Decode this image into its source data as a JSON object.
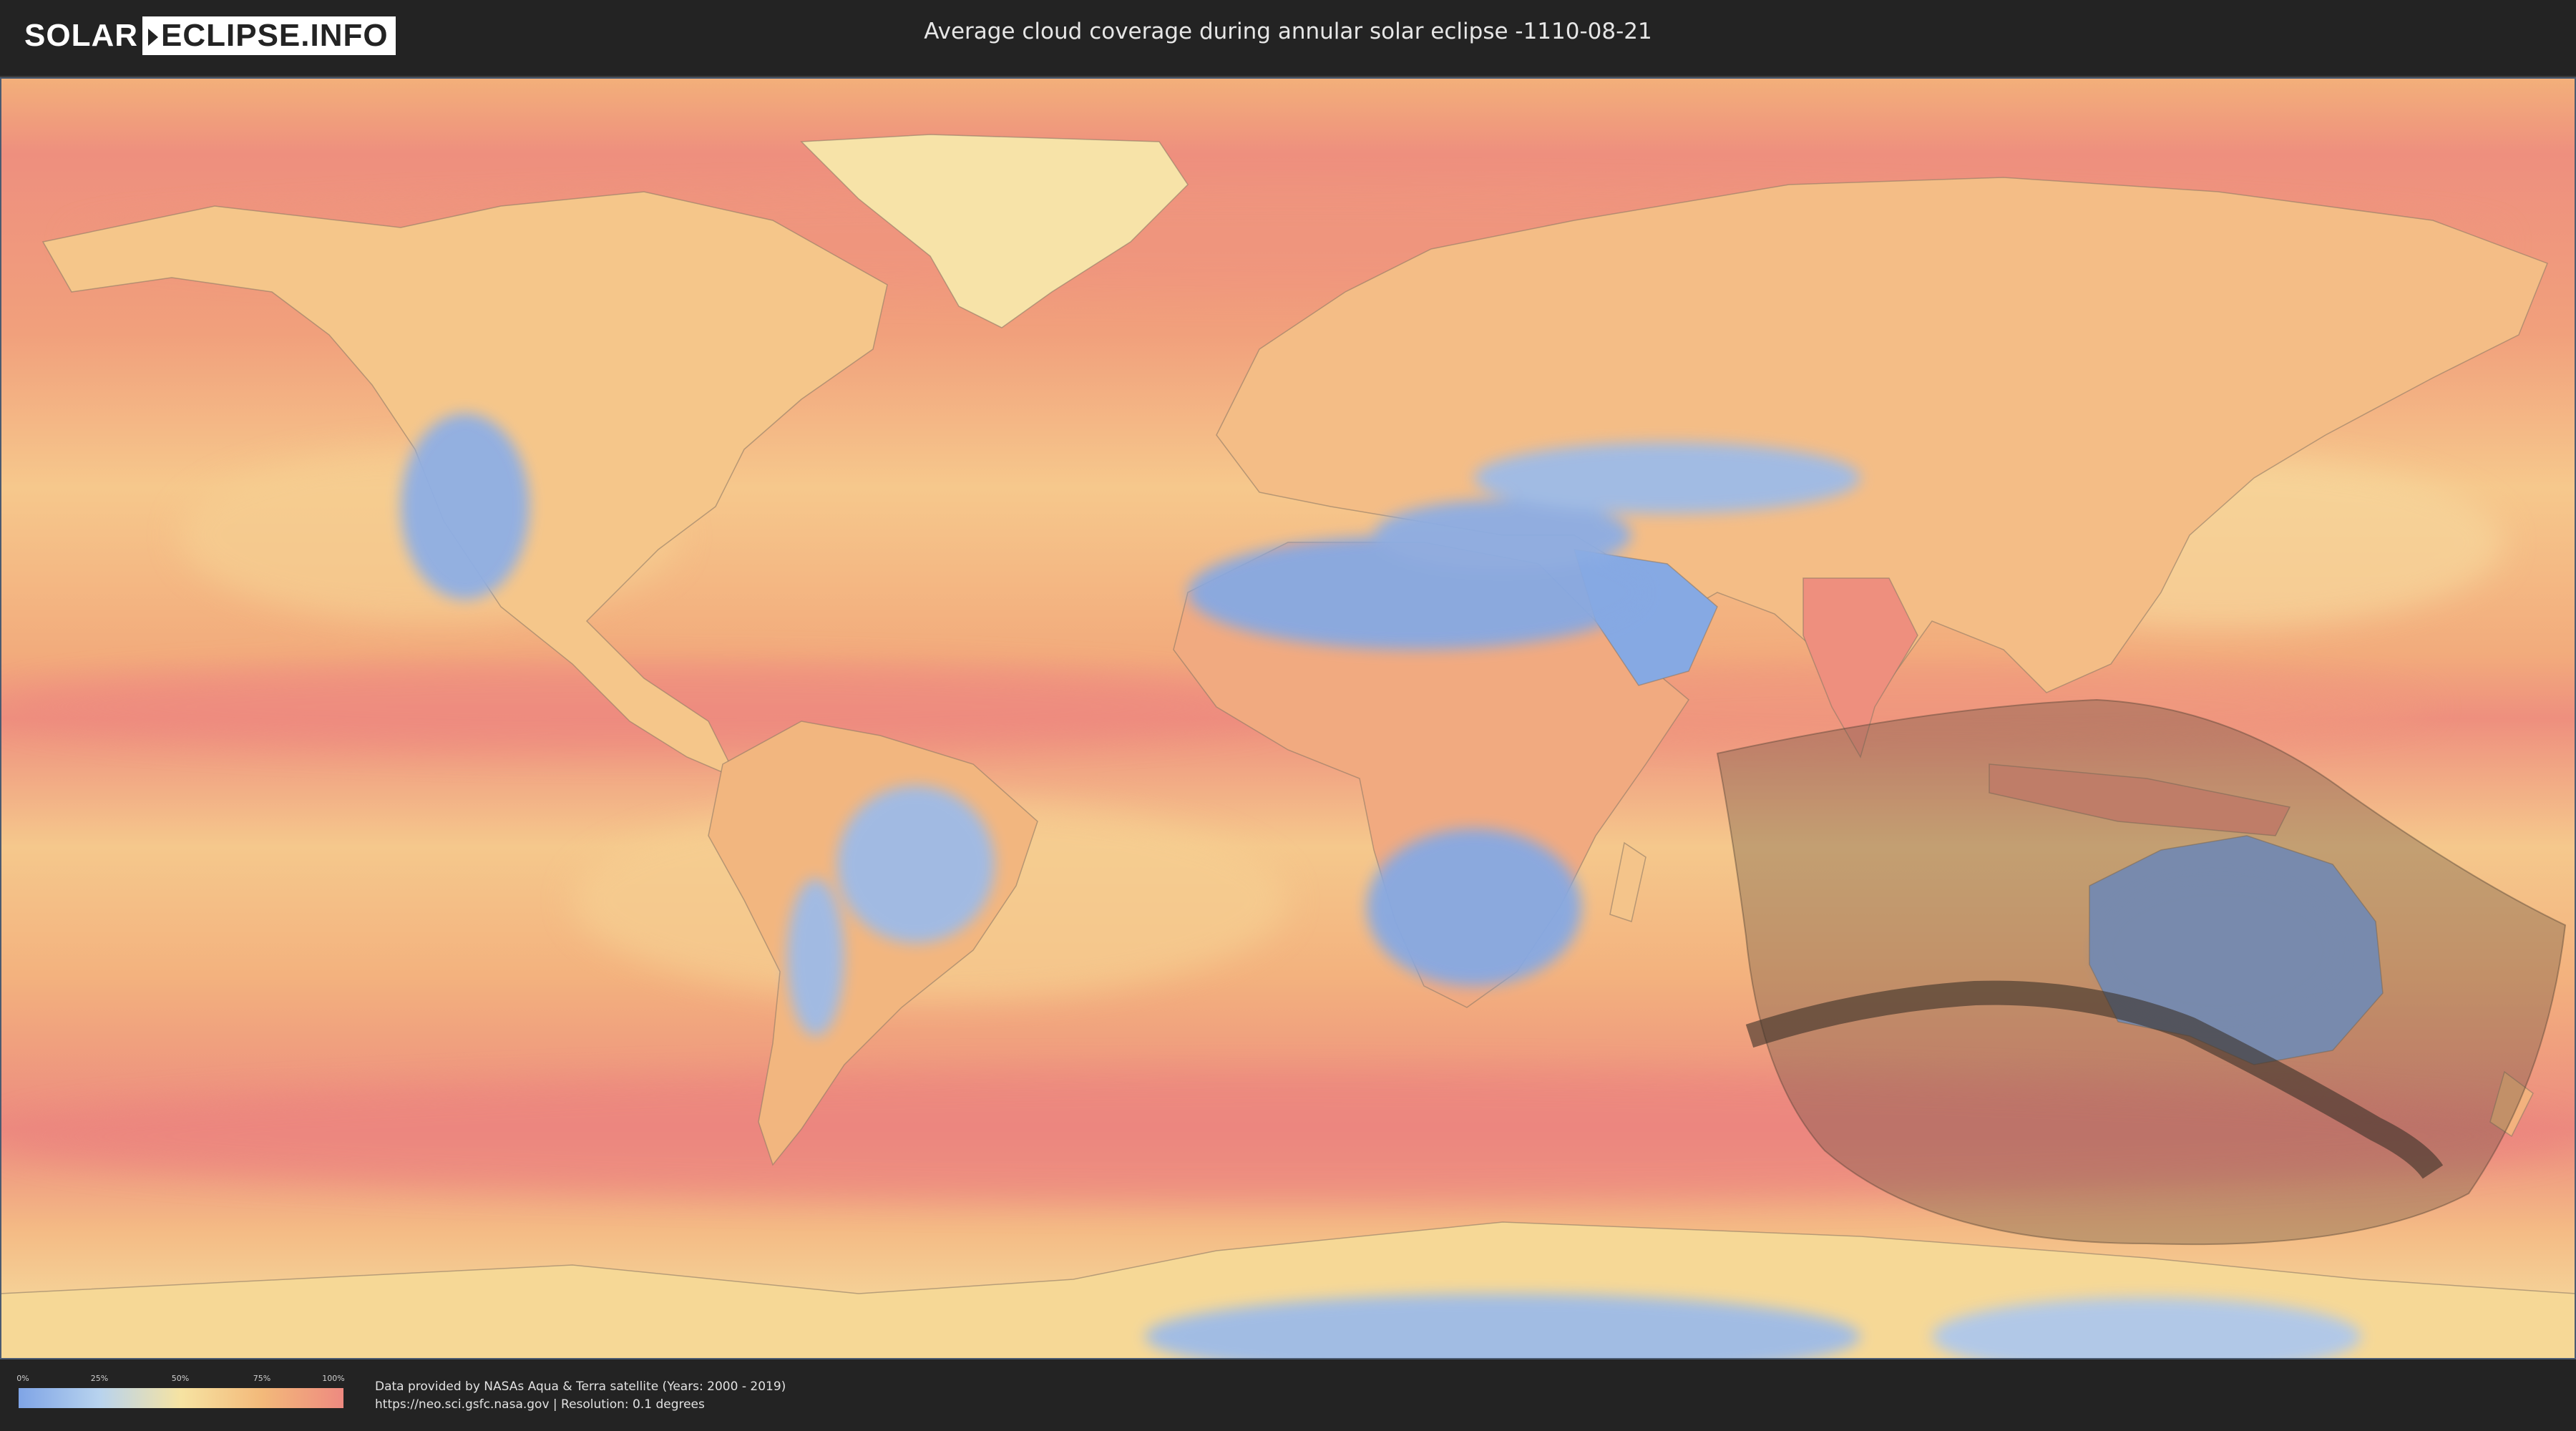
{
  "header": {
    "logo_part1": "SOLAR",
    "logo_part2": "ECLIPSE.INFO",
    "title": "Average cloud coverage during annular solar eclipse -1110-08-21"
  },
  "map": {
    "layer": "average cloud coverage",
    "colors": {
      "clear": "#7fa4e6",
      "low": "#b8d3ee",
      "mid": "#f6e3a2",
      "high": "#f3b97a",
      "overcast": "#ee8a80",
      "eclipse_zone": "#5a4a3a",
      "central_path": "#3b3028"
    }
  },
  "legend": {
    "ticks": [
      "0%",
      "25%",
      "50%",
      "75%",
      "100%"
    ]
  },
  "credits": {
    "line1": "Data provided by NASAs Aqua & Terra satellite (Years: 2000 - 2019)",
    "line2": "https://neo.sci.gsfc.nasa.gov | Resolution: 0.1 degrees"
  }
}
